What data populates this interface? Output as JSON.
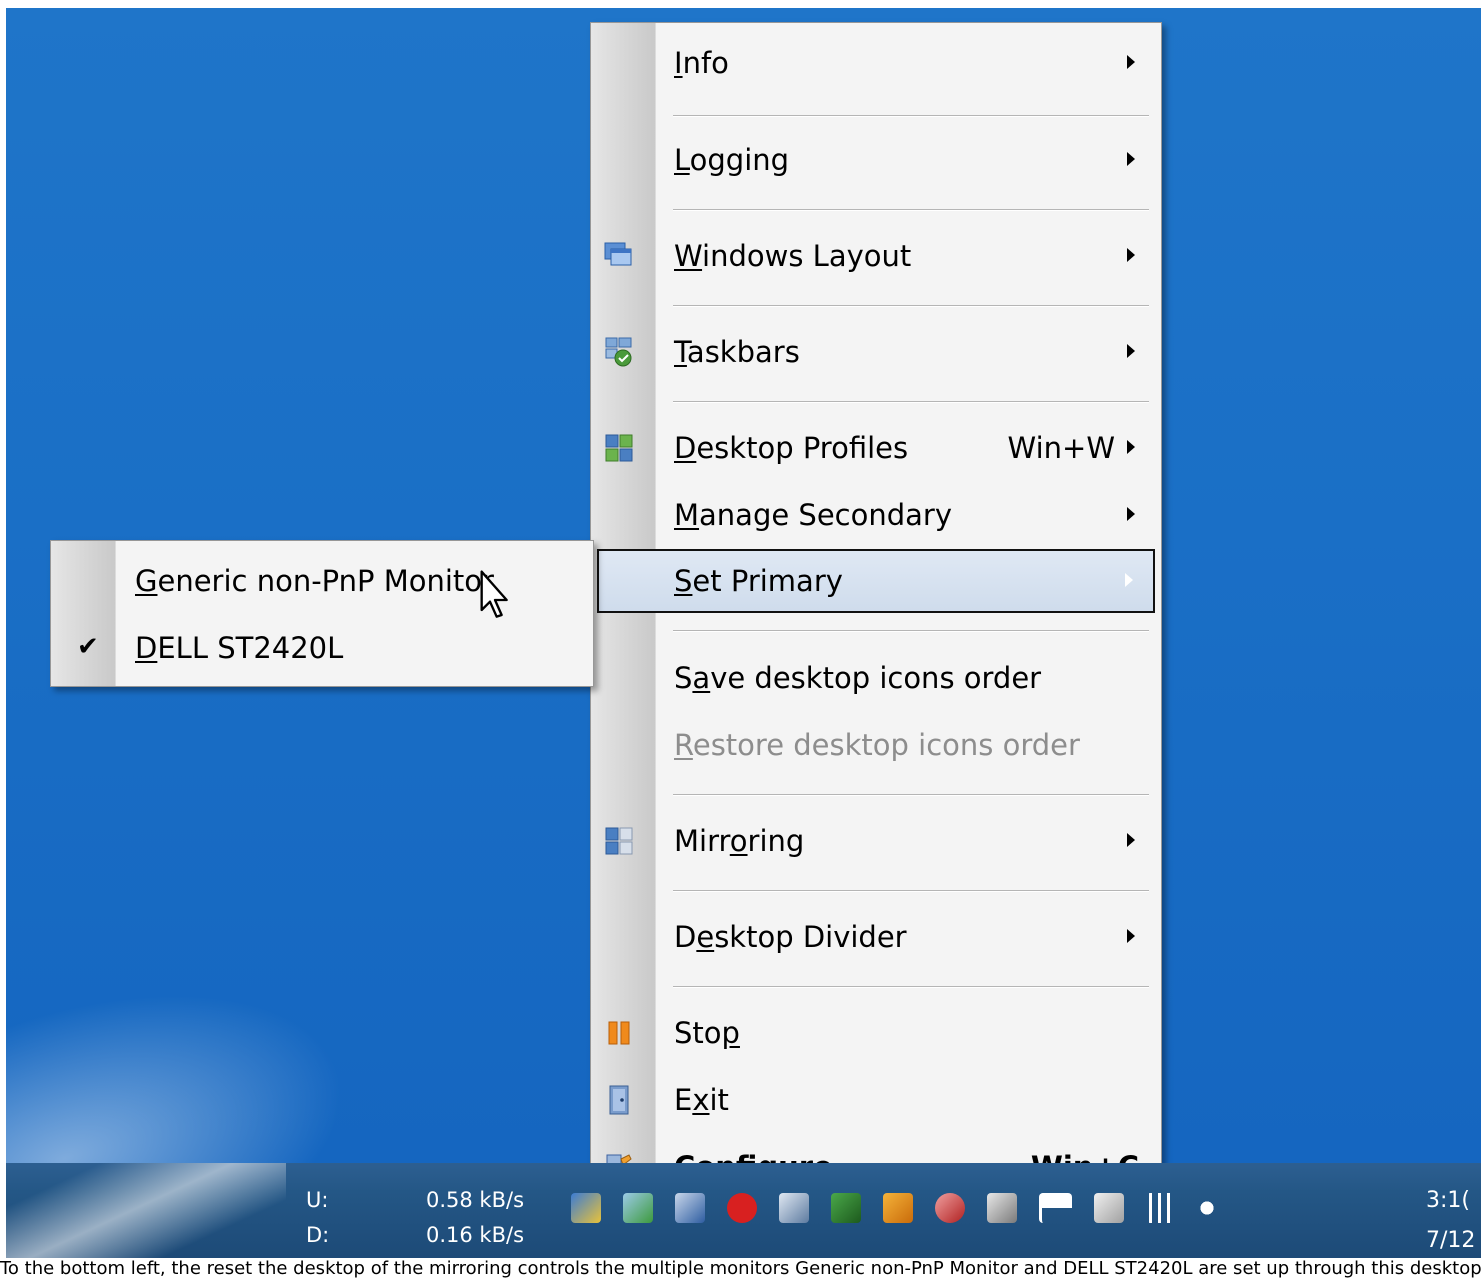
{
  "desktop": {},
  "context_menu": {
    "items": [
      {
        "label": "Info",
        "access": "I",
        "submenu": true
      },
      {
        "label": "Logging",
        "access": "L",
        "submenu": true
      },
      {
        "label": "Windows Layout",
        "access": "W",
        "submenu": true,
        "icon": "windows-layout-icon"
      },
      {
        "label": "Taskbars",
        "access": "T",
        "submenu": true,
        "icon": "taskbars-icon"
      },
      {
        "label": "Desktop Profiles",
        "access": "D",
        "shortcut": "Win+W",
        "submenu": true,
        "icon": "desktop-profiles-icon"
      },
      {
        "label": "Manage Secondary",
        "access": "M",
        "submenu": true
      },
      {
        "label": "Set Primary",
        "access": "S",
        "submenu": true,
        "highlighted": true
      },
      {
        "label": "Save desktop icons order",
        "access": "a"
      },
      {
        "label": "Restore desktop icons order",
        "access": "R",
        "disabled": true
      },
      {
        "label": "Mirroring",
        "access": "o",
        "submenu": true,
        "icon": "mirroring-icon"
      },
      {
        "label": "Desktop Divider",
        "access": "e",
        "submenu": true
      },
      {
        "label": "Stop",
        "access": "p",
        "icon": "pause-icon"
      },
      {
        "label": "Exit",
        "access": "x",
        "icon": "exit-door-icon"
      },
      {
        "label": "Configure...",
        "access": "C",
        "shortcut": "Win+C",
        "bold": true,
        "icon": "configure-tools-icon"
      }
    ]
  },
  "set_primary_submenu": {
    "items": [
      {
        "label": "Generic non-PnP Monitor",
        "checked": false
      },
      {
        "label": "DELL ST2420L",
        "checked": true
      }
    ]
  },
  "taskbar": {
    "net_upload_label": "U:",
    "net_upload_value": "0.58 kB/s",
    "net_download_label": "D:",
    "net_download_value": "0.16 kB/s",
    "clock_time": "3:1(",
    "clock_date": "7/12"
  },
  "footer_text": "To the bottom left, the reset the desktop of the mirroring controls the multiple monitors Generic non-PnP Monitor and DELL ST2420L are set up through this desktop tool menu"
}
